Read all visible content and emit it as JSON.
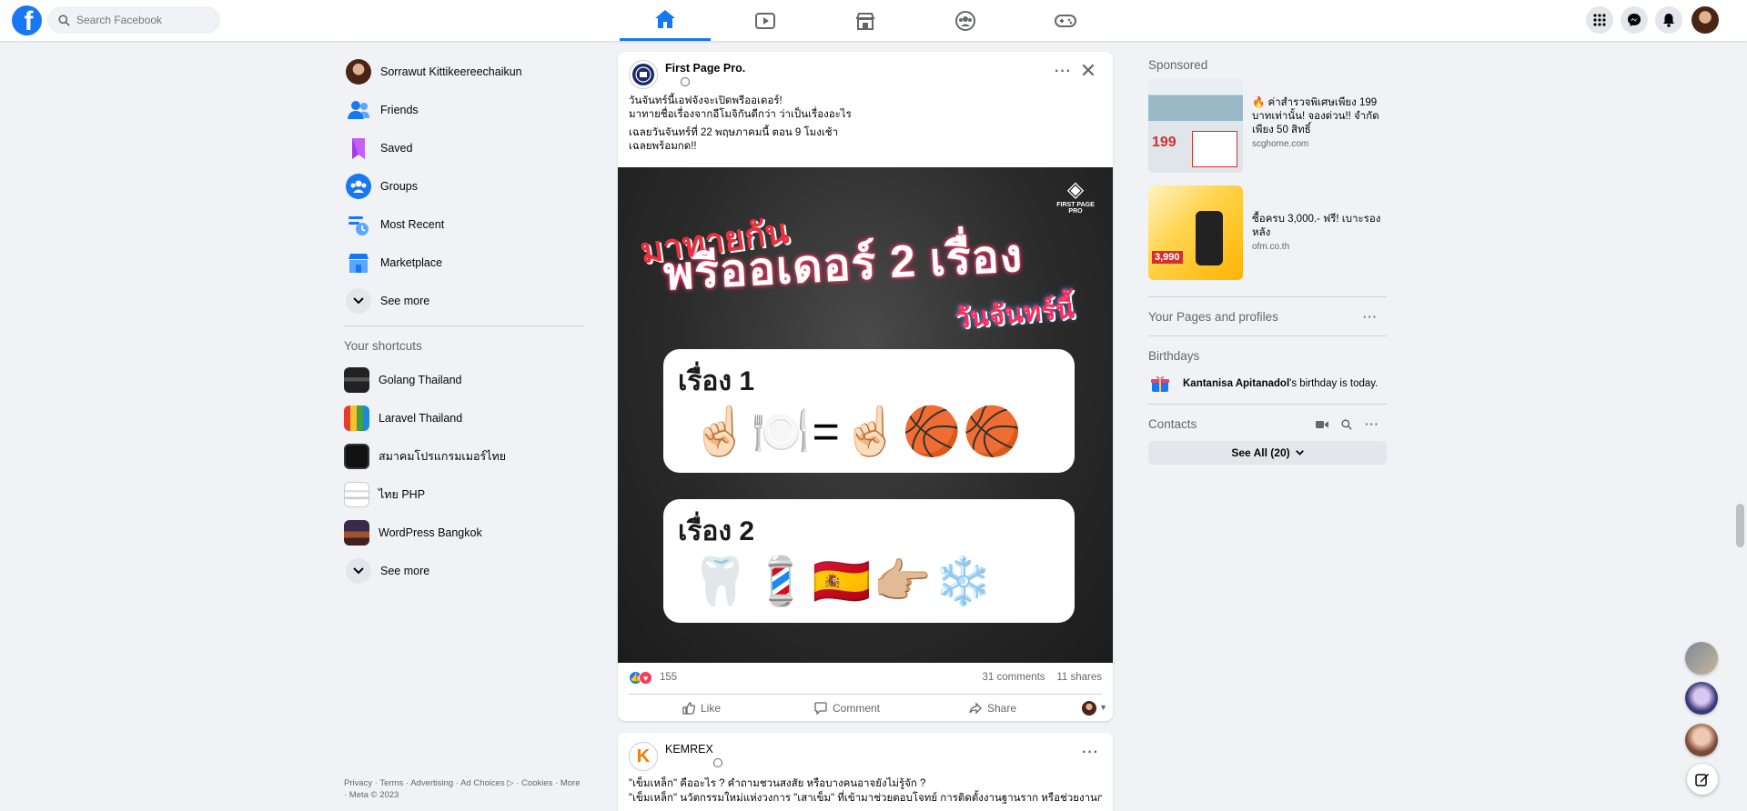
{
  "topbar": {
    "logo": "f",
    "search_placeholder": "Search Facebook",
    "nav_icons": [
      "home-icon",
      "watch-icon",
      "marketplace-icon",
      "groups-icon",
      "gaming-icon"
    ]
  },
  "left_nav": {
    "items": [
      {
        "label": "Sorrawut Kittikeereechaikun"
      },
      {
        "label": "Friends"
      },
      {
        "label": "Saved"
      },
      {
        "label": "Groups"
      },
      {
        "label": "Most Recent"
      },
      {
        "label": "Marketplace"
      },
      {
        "label": "See more"
      }
    ],
    "shortcuts_title": "Your shortcuts",
    "shortcuts": [
      {
        "label": "Golang Thailand"
      },
      {
        "label": "Laravel Thailand"
      },
      {
        "label": "สมาคมโปรแกรมเมอร์ไทย"
      },
      {
        "label": "ไทย PHP"
      },
      {
        "label": "WordPress Bangkok"
      },
      {
        "label": "See more"
      }
    ],
    "footer": "Privacy · Terms · Advertising · Ad Choices ▷ · Cookies · More · Meta © 2023"
  },
  "post1": {
    "page_name": "First Page Pro.",
    "text_line1": "วันจันทร์นี้เอฟจังจะเปิดพรีออเดอร์!",
    "text_line2": "มาทายชื่อเรื่องจากอีโมจิกันดีกว่า ว่าเป็นเรื่องอะไร",
    "text_line3": "เฉลยวันจันทร์ที่ 22 พฤษภาคมนี้ ตอน 9 โมงเช้า",
    "text_line4": "เฉลยพร้อมกด!!",
    "image": {
      "tag1": "มาทายกัน",
      "title": "พรีออเดอร์ 2 เรื่อง",
      "tag2": "วันจันทร์นี้",
      "brand": "FIRST PAGE PRO",
      "card1_title": "เรื่อง 1",
      "card1_emojis": "☝🏻🍽️=☝🏻🏀🏀",
      "card2_title": "เรื่อง 2",
      "card2_emojis": "🦷💈🇪🇸👉🏼❄️"
    },
    "reactions_count": "155",
    "comments": "31 comments",
    "shares": "11 shares",
    "actions": {
      "like": "Like",
      "comment": "Comment",
      "share": "Share"
    }
  },
  "post2": {
    "page_name": "KEMREX",
    "avatar_letter": "K",
    "text_line1": "\"เข็มเหล็ก\" คืออะไร ? คำถามชวนสงสัย หรือบางคนอาจยังไม่รู้จัก ?",
    "text_line2": "\"เข็มเหล็ก\" นวัตกรรมใหม่แห่งวงการ \"เสาเข็ม\" ที่เข้ามาช่วยตอบโจทย์ การติดตั้งงานฐานราก หรือช่วยงานก่อ"
  },
  "right": {
    "sponsored_title": "Sponsored",
    "ads": [
      {
        "text": "🔥 ค่าสำรวจพิเศษเพียง 199 บาทเท่านั้น! จองด่วน!! จำกัดเพียง 50 สิทธิ์",
        "url": "scghome.com",
        "price_tag": "199"
      },
      {
        "text": "ซื้อครบ 3,000.- ฟรี! เบาะรองหลัง",
        "url": "ofm.co.th",
        "price_tag": "3,990"
      }
    ],
    "pages_title": "Your Pages and profiles",
    "birthdays_title": "Birthdays",
    "birthday_name": "Kantanisa Apitanadol",
    "birthday_suffix": "'s birthday is today.",
    "contacts_title": "Contacts",
    "see_all": "See All (20)"
  },
  "colors": {
    "brand": "#1877f2",
    "bg": "#f0f2f5"
  }
}
